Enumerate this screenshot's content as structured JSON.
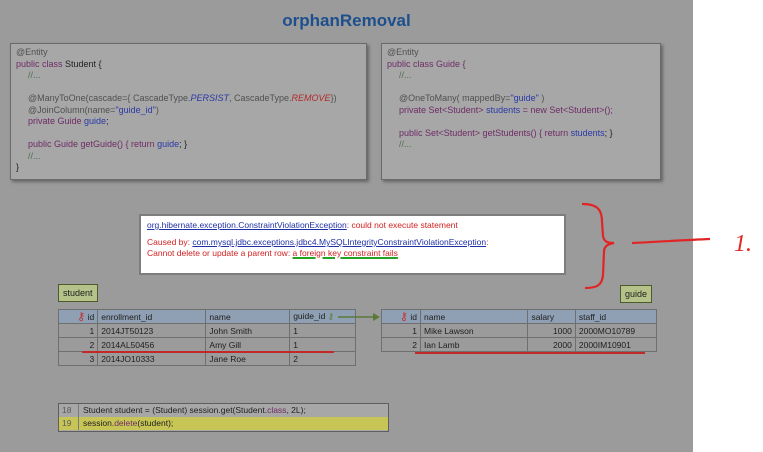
{
  "title": "orphanRemoval",
  "student_class": {
    "l1": "@Entity",
    "l2a": "public class ",
    "l2b": "Student {",
    "l3": "//...",
    "l5a": "@ManyToOne(cascade={ CascadeType.",
    "l5b": "PERSIST",
    "l5c": ", CascadeType.",
    "l5d": "REMOVE",
    "l5e": "})",
    "l6a": "@JoinColumn(name=",
    "l6b": "\"guide_id\"",
    "l6c": ")",
    "l7a": "private Guide ",
    "l7b": "guide",
    "l7c": ";",
    "l9a": "public Guide getGuide() { return ",
    "l9b": "guide",
    "l9c": "; }",
    "l10": "//...",
    "l11": "}"
  },
  "guide_class": {
    "l1": "@Entity",
    "l2": "public class Guide {",
    "l3": "//...",
    "l5a": "@OneToMany( mappedBy=",
    "l5b": "\"guide\"",
    "l5c": " )",
    "l6a": "private Set<Student> ",
    "l6b": "students",
    "l6c": " = new Set<Student>();",
    "l8a": "public Set<Student> getStudents() { return ",
    "l8b": "students",
    "l8c": "; }",
    "l9": "//..."
  },
  "error": {
    "exception_link": "org.hibernate.exception.ConstraintViolationException",
    "exception_rest": ": could not execute statement",
    "caused_prefix": "Caused by: ",
    "caused_link": "com.mysql.jdbc.exceptions.jdbc4.MySQLIntegrityConstraintViolationException",
    "caused_suffix": ":",
    "line3_prefix": "Cannot delete or update a parent row: ",
    "line3_highlight": "a foreign key constraint fails"
  },
  "annotation": {
    "label": "1."
  },
  "student_table": {
    "tag": "student",
    "headers": [
      "id",
      "enrollment_id",
      "name",
      "guide_id"
    ],
    "rows": [
      [
        "1",
        "2014JT50123",
        "John Smith",
        "1"
      ],
      [
        "2",
        "2014AL50456",
        "Amy Gill",
        "1"
      ],
      [
        "3",
        "2014JO10333",
        "Jane Roe",
        "2"
      ]
    ]
  },
  "guide_table": {
    "tag": "guide",
    "headers": [
      "id",
      "name",
      "salary",
      "staff_id"
    ],
    "rows": [
      [
        "1",
        "Mike Lawson",
        "1000",
        "2000MO10789"
      ],
      [
        "2",
        "Ian Lamb",
        "2000",
        "2000IM10901"
      ]
    ]
  },
  "code_footer": {
    "line18_no": "18",
    "line18_a": "Student student = (Student) session.get(Student.",
    "line18_b": "class",
    "line18_c": ", 2L);",
    "line19_no": "19",
    "line19_a": "session.",
    "line19_b": "delete",
    "line19_c": "(student);"
  }
}
